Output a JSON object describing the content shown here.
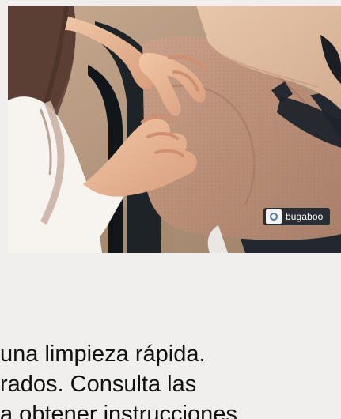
{
  "product_photo": {
    "alt": "",
    "brand_tag": {
      "badge": "circle-badge-icon",
      "text": "bugaboo"
    }
  },
  "description": {
    "line_1": "una limpieza rápida.",
    "line_2": "rados. Consulta las",
    "line_3": "a obtener instrucciones"
  }
}
